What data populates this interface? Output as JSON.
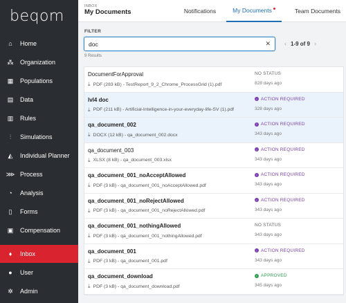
{
  "sidebar": {
    "logo": "beqom",
    "items": [
      {
        "label": "Home",
        "icon": "home-icon",
        "glyph": "⌂"
      },
      {
        "label": "Organization",
        "icon": "organization-icon",
        "glyph": "⁂"
      },
      {
        "label": "Populations",
        "icon": "populations-icon",
        "glyph": "▦"
      },
      {
        "label": "Data",
        "icon": "data-icon",
        "glyph": "▤"
      },
      {
        "label": "Rules",
        "icon": "rules-icon",
        "glyph": "▥"
      },
      {
        "label": "Simulations",
        "icon": "simulations-icon",
        "glyph": "⫶"
      },
      {
        "label": "Individual Planner",
        "icon": "individual-planner-icon",
        "glyph": "◭"
      },
      {
        "label": "Process",
        "icon": "process-icon",
        "glyph": "⋙"
      },
      {
        "label": "Analysis",
        "icon": "analysis-icon",
        "glyph": "◔"
      },
      {
        "label": "Forms",
        "icon": "forms-icon",
        "glyph": "▯"
      },
      {
        "label": "Compensation",
        "icon": "compensation-icon",
        "glyph": "▣"
      },
      {
        "label": "Inbox",
        "icon": "inbox-icon",
        "glyph": "♦",
        "active": true
      },
      {
        "label": "User",
        "icon": "user-icon",
        "glyph": "●"
      },
      {
        "label": "Admin",
        "icon": "admin-icon",
        "glyph": "✲"
      }
    ]
  },
  "header": {
    "section": "INBOX",
    "title": "My Documents",
    "tabs": [
      {
        "label": "Notifications"
      },
      {
        "label": "My Documents",
        "active": true
      },
      {
        "label": "Team Documents"
      }
    ]
  },
  "filter": {
    "label": "FILTER",
    "value": "doc",
    "clear_icon": "✕",
    "results": "9 Results"
  },
  "pager": {
    "text": "1-9 of 9",
    "prev": "‹",
    "next": "›"
  },
  "colors": {
    "accent": "#1f6fb5",
    "sidebar_bg": "#2a2d31",
    "active_red": "#d9232e",
    "action_required": "#7b3fb0",
    "approved": "#2e9e4f"
  },
  "documents": [
    {
      "name": "DocumentForApproval",
      "meta": "PDF (283 kB) - TestReport_9_2_Chrome_ProcessGrid (1).pdf",
      "status": "NO STATUS",
      "status_type": "none",
      "date": "828 days ago",
      "bold": false,
      "highlight": false
    },
    {
      "name": "lvl4 doc",
      "meta": "PDF (211 kB) - Artificial-Intelligence-in-your-everyday-life-SV (1).pdf",
      "status": "ACTION REQUIRED",
      "status_type": "action",
      "date": "328 days ago",
      "bold": true,
      "highlight": true
    },
    {
      "name": "qa_document_002",
      "meta": "DOCX (12 kB) - qa_document_002.docx",
      "status": "ACTION REQUIRED",
      "status_type": "action",
      "date": "343 days ago",
      "bold": true,
      "highlight": true
    },
    {
      "name": "qa_document_003",
      "meta": "XLSX (8 kB) - qa_document_003.xlsx",
      "status": "ACTION REQUIRED",
      "status_type": "action",
      "date": "343 days ago",
      "bold": false,
      "highlight": false
    },
    {
      "name": "qa_document_001_noAcceptAllowed",
      "meta": "PDF (3 kB) - qa_document_001_noAcceptAllowed.pdf",
      "status": "ACTION REQUIRED",
      "status_type": "action",
      "date": "343 days ago",
      "bold": true,
      "highlight": false
    },
    {
      "name": "qa_document_001_noRejectAllowed",
      "meta": "PDF (3 kB) - qa_document_001_noRejectAllowed.pdf",
      "status": "ACTION REQUIRED",
      "status_type": "action",
      "date": "343 days ago",
      "bold": true,
      "highlight": false
    },
    {
      "name": "qa_document_001_nothingAllowed",
      "meta": "PDF (3 kB) - qa_document_001_nothingAllowed.pdf",
      "status": "NO STATUS",
      "status_type": "none",
      "date": "343 days ago",
      "bold": true,
      "highlight": false
    },
    {
      "name": "qa_document_001",
      "meta": "PDF (3 kB) - qa_document_001.pdf",
      "status": "ACTION REQUIRED",
      "status_type": "action",
      "date": "343 days ago",
      "bold": true,
      "highlight": false
    },
    {
      "name": "qa_document_download",
      "meta": "PDF (3 kB) - qa_document_download.pdf",
      "status": "APPROVED",
      "status_type": "approved",
      "date": "345 days ago",
      "bold": true,
      "highlight": false
    }
  ],
  "download_glyph": "⤓"
}
